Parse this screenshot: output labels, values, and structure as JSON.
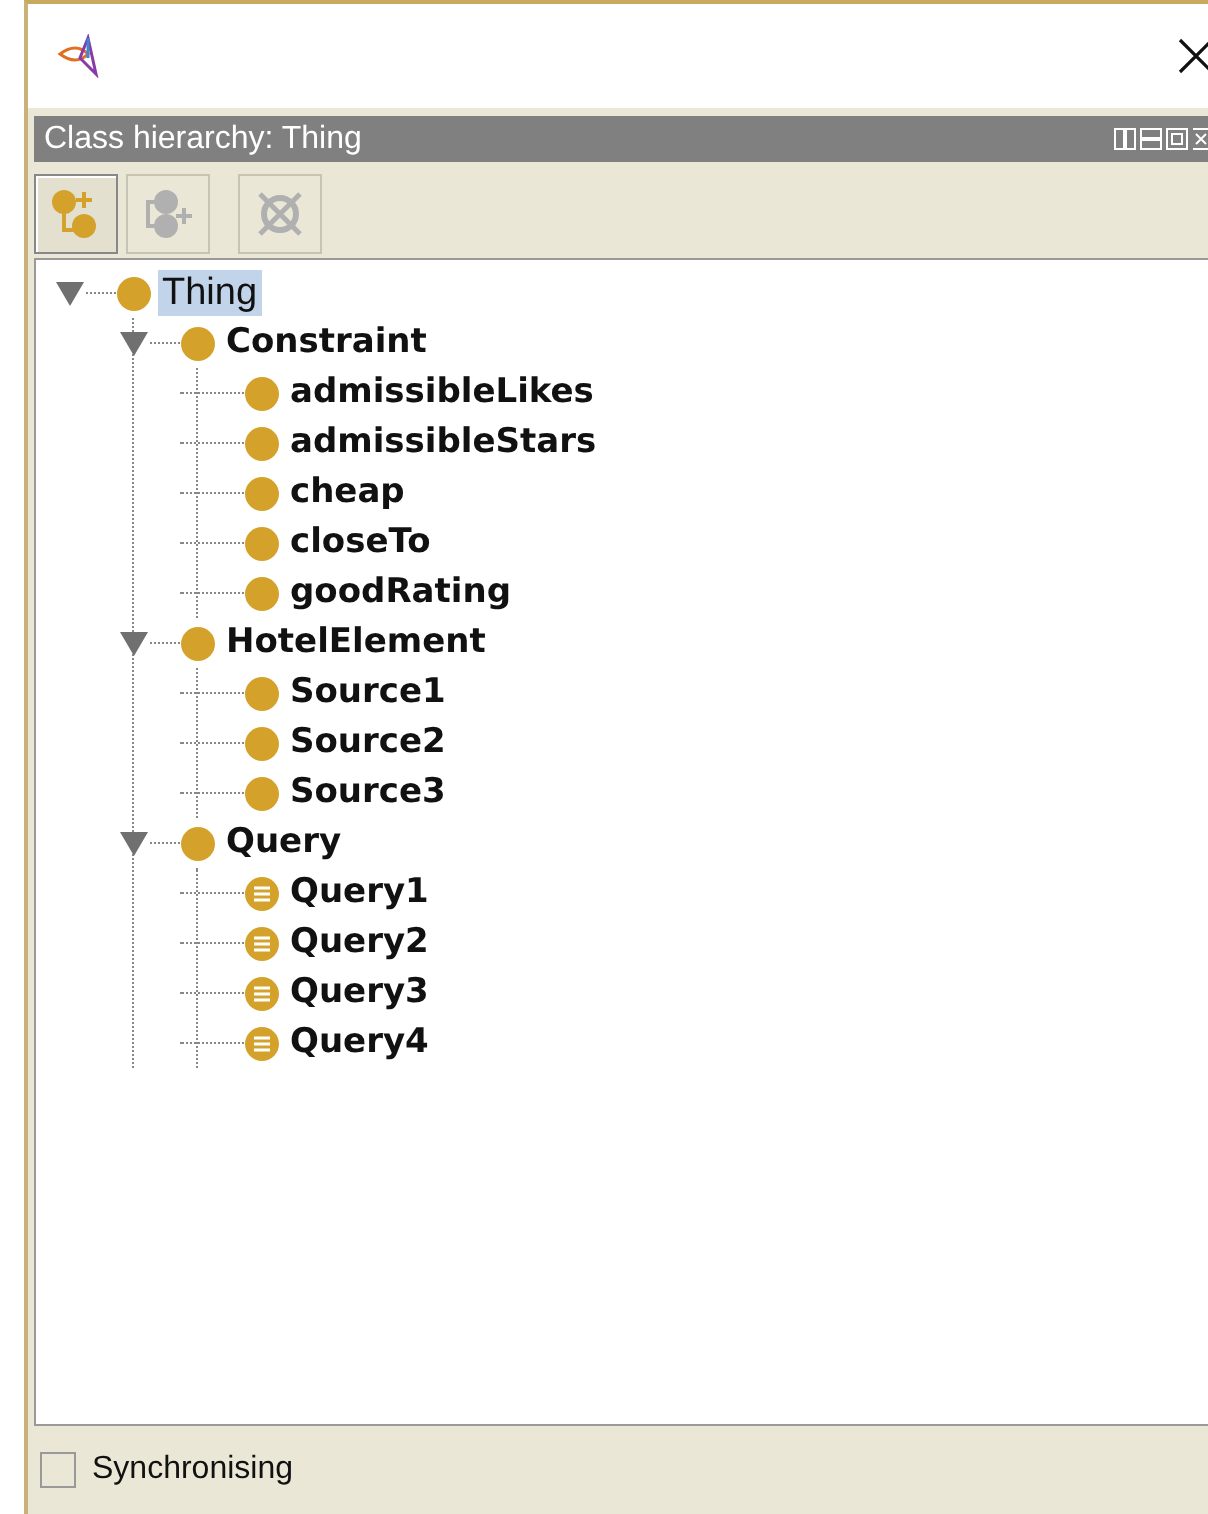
{
  "view": {
    "title": "Class hierarchy: Thing"
  },
  "toolbar": [
    {
      "kind": "add-subclass",
      "disabled": false
    },
    {
      "kind": "add-sibling",
      "disabled": true
    },
    {
      "kind": "delete",
      "disabled": true
    }
  ],
  "tree": [
    {
      "label": "Thing",
      "kind": "class",
      "selected": true,
      "expanded": true,
      "children": [
        {
          "label": "Constraint",
          "kind": "class",
          "selected": false,
          "expanded": true,
          "children": [
            {
              "label": "admissibleLikes",
              "kind": "class",
              "selected": false
            },
            {
              "label": "admissibleStars",
              "kind": "class",
              "selected": false
            },
            {
              "label": "cheap",
              "kind": "class",
              "selected": false
            },
            {
              "label": "closeTo",
              "kind": "class",
              "selected": false
            },
            {
              "label": "goodRating",
              "kind": "class",
              "selected": false
            }
          ]
        },
        {
          "label": "HotelElement",
          "kind": "class",
          "selected": false,
          "expanded": true,
          "children": [
            {
              "label": "Source1",
              "kind": "class",
              "selected": false
            },
            {
              "label": "Source2",
              "kind": "class",
              "selected": false
            },
            {
              "label": "Source3",
              "kind": "class",
              "selected": false
            }
          ]
        },
        {
          "label": "Query",
          "kind": "class",
          "selected": false,
          "expanded": true,
          "children": [
            {
              "label": "Query1",
              "kind": "defined",
              "selected": false
            },
            {
              "label": "Query2",
              "kind": "defined",
              "selected": false
            },
            {
              "label": "Query3",
              "kind": "defined",
              "selected": false
            },
            {
              "label": "Query4",
              "kind": "defined",
              "selected": false
            }
          ]
        }
      ]
    }
  ],
  "sync": {
    "label": "Synchronising",
    "checked": false
  }
}
